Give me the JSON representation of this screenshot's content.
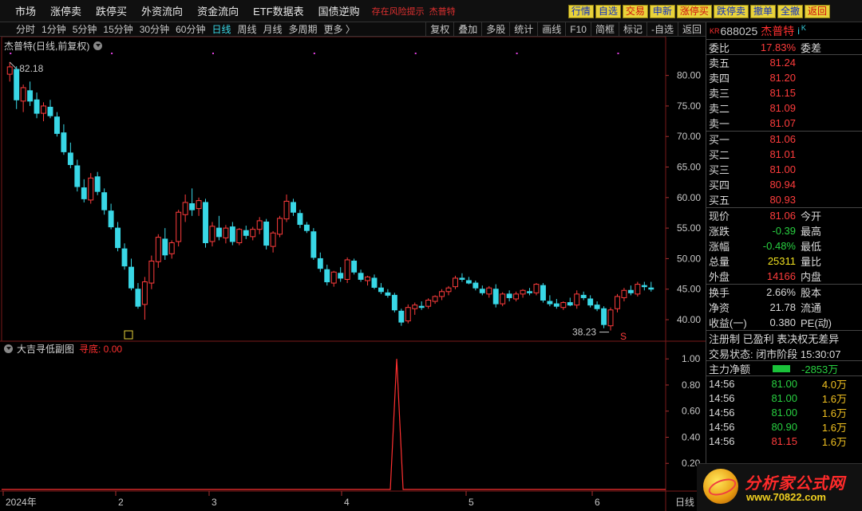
{
  "menu": {
    "items": [
      "市场",
      "涨停卖",
      "跌停买",
      "外资流向",
      "资金流向",
      "ETF数据表",
      "国债逆购"
    ],
    "warning": "存在风险提示",
    "stock_tag": "杰普特"
  },
  "quick_buttons": [
    {
      "label": "行情",
      "color": "blue"
    },
    {
      "label": "自选",
      "color": "blue"
    },
    {
      "label": "交易",
      "color": "red"
    },
    {
      "label": "申新",
      "color": "blue"
    },
    {
      "label": "涨停买",
      "color": "red"
    },
    {
      "label": "跌停卖",
      "color": "blue"
    },
    {
      "label": "撤单",
      "color": "blue"
    },
    {
      "label": "全撤",
      "color": "blue"
    },
    {
      "label": "返回",
      "color": "red"
    }
  ],
  "toolbar": {
    "periods": [
      "分时",
      "1分钟",
      "5分钟",
      "15分钟",
      "30分钟",
      "60分钟",
      "日线",
      "周线",
      "月线",
      "多周期",
      "更多 〉"
    ],
    "active_period": "日线",
    "right_buttons": [
      "复权",
      "叠加",
      "多股",
      "统计",
      "画线",
      "F10",
      "简框",
      "标记",
      "-自选",
      "返回"
    ]
  },
  "main_chart": {
    "title": "杰普特(日线,前复权)",
    "high_label": "82.18",
    "low_label": "38.23",
    "y_ticks": [
      "80.00",
      "75.00",
      "70.00",
      "65.00",
      "60.00",
      "55.00",
      "50.00",
      "45.00",
      "40.00"
    ],
    "x_labels": [
      "2024年",
      "2",
      "3",
      "4",
      "5",
      "6"
    ],
    "period_label": "日线",
    "signal_mark": "S",
    "box_mark": "回"
  },
  "sub_chart": {
    "title": "大吉寻低副图",
    "indicator_label": "寻底: 0.00",
    "y_ticks": [
      "1.00",
      "0.80",
      "0.60",
      "0.40",
      "0.20"
    ]
  },
  "chart_data": [
    {
      "type": "candlestick",
      "title": "杰普特(日线,前复权)",
      "ylim": [
        37,
        84
      ],
      "x_labels": [
        "2024年",
        "2",
        "3",
        "4",
        "5",
        "6"
      ],
      "candles": [
        [
          80.2,
          82.18,
          79.0,
          81.4
        ],
        [
          81.0,
          81.5,
          74.5,
          76.0
        ],
        [
          75.8,
          78.5,
          74.0,
          78.0
        ],
        [
          77.5,
          79.0,
          75.0,
          75.8
        ],
        [
          76.0,
          77.2,
          73.0,
          73.8
        ],
        [
          73.8,
          75.6,
          72.5,
          75.0
        ],
        [
          74.8,
          76.0,
          73.0,
          73.4
        ],
        [
          73.2,
          74.0,
          70.0,
          70.5
        ],
        [
          70.6,
          72.0,
          67.0,
          67.5
        ],
        [
          67.3,
          69.0,
          64.8,
          65.4
        ],
        [
          65.2,
          66.2,
          61.0,
          61.8
        ],
        [
          61.6,
          63.0,
          59.2,
          59.8
        ],
        [
          59.6,
          64.0,
          59.0,
          63.2
        ],
        [
          63.4,
          64.2,
          60.4,
          61.0
        ],
        [
          60.8,
          61.5,
          57.2,
          58.0
        ],
        [
          57.8,
          59.0,
          54.8,
          55.2
        ],
        [
          55.0,
          56.0,
          51.2,
          51.8
        ],
        [
          51.6,
          52.5,
          48.2,
          48.8
        ],
        [
          48.6,
          50.0,
          44.8,
          45.2
        ],
        [
          45.0,
          46.0,
          41.8,
          42.2
        ],
        [
          42.5,
          47.0,
          40.0,
          46.2
        ],
        [
          46.0,
          50.5,
          45.0,
          49.6
        ],
        [
          49.5,
          54.0,
          48.5,
          53.5
        ],
        [
          53.2,
          55.0,
          49.8,
          50.6
        ],
        [
          50.8,
          53.0,
          50.0,
          52.6
        ],
        [
          52.8,
          58.0,
          52.0,
          57.6
        ],
        [
          57.2,
          60.5,
          56.0,
          59.2
        ],
        [
          59.0,
          61.5,
          57.0,
          58.0
        ],
        [
          58.2,
          60.0,
          57.0,
          59.5
        ],
        [
          59.2,
          59.8,
          51.8,
          52.6
        ],
        [
          52.8,
          56.0,
          52.0,
          55.3
        ],
        [
          55.0,
          57.0,
          53.0,
          53.6
        ],
        [
          53.4,
          55.5,
          52.5,
          55.0
        ],
        [
          55.2,
          56.0,
          52.2,
          52.8
        ],
        [
          52.6,
          55.0,
          52.2,
          54.8
        ],
        [
          54.6,
          55.4,
          53.2,
          53.8
        ],
        [
          53.6,
          55.2,
          53.0,
          54.8
        ],
        [
          54.8,
          56.8,
          54.0,
          56.2
        ],
        [
          56.0,
          56.5,
          51.5,
          52.2
        ],
        [
          52.0,
          54.5,
          51.0,
          54.2
        ],
        [
          54.0,
          57.0,
          53.5,
          56.6
        ],
        [
          56.5,
          60.5,
          56.0,
          59.4
        ],
        [
          59.2,
          59.8,
          57.0,
          57.6
        ],
        [
          57.4,
          58.0,
          55.0,
          55.6
        ],
        [
          55.5,
          56.0,
          54.2,
          54.6
        ],
        [
          54.4,
          55.0,
          49.8,
          50.2
        ],
        [
          50.0,
          51.0,
          47.8,
          48.4
        ],
        [
          48.2,
          49.0,
          45.6,
          46.2
        ],
        [
          46.0,
          48.0,
          45.4,
          47.8
        ],
        [
          47.6,
          48.6,
          46.2,
          46.8
        ],
        [
          46.6,
          50.2,
          46.0,
          49.8
        ],
        [
          49.6,
          50.0,
          47.4,
          47.8
        ],
        [
          47.6,
          48.2,
          46.2,
          46.6
        ],
        [
          46.4,
          47.2,
          45.6,
          47.0
        ],
        [
          46.8,
          47.4,
          45.0,
          45.3
        ],
        [
          45.2,
          46.0,
          44.2,
          44.6
        ],
        [
          44.4,
          45.0,
          43.6,
          44.0
        ],
        [
          44.0,
          44.4,
          41.2,
          41.6
        ],
        [
          41.4,
          41.8,
          39.0,
          39.6
        ],
        [
          39.8,
          42.5,
          39.4,
          42.0
        ],
        [
          41.8,
          42.8,
          40.8,
          42.4
        ],
        [
          42.2,
          43.0,
          41.6,
          42.0
        ],
        [
          42.2,
          43.5,
          41.8,
          43.2
        ],
        [
          43.0,
          44.0,
          42.6,
          43.8
        ],
        [
          43.8,
          45.0,
          43.2,
          44.6
        ],
        [
          44.6,
          45.5,
          44.0,
          45.2
        ],
        [
          45.4,
          47.2,
          45.0,
          46.8
        ],
        [
          46.8,
          47.6,
          46.2,
          46.6
        ],
        [
          46.4,
          47.0,
          45.8,
          46.0
        ],
        [
          46.0,
          46.4,
          44.8,
          45.2
        ],
        [
          45.0,
          45.6,
          44.0,
          44.4
        ],
        [
          44.2,
          45.5,
          43.6,
          45.2
        ],
        [
          45.0,
          45.8,
          42.0,
          42.6
        ],
        [
          42.6,
          44.5,
          42.2,
          44.2
        ],
        [
          44.2,
          44.8,
          43.0,
          43.6
        ],
        [
          43.4,
          44.6,
          43.0,
          44.2
        ],
        [
          44.2,
          45.0,
          43.6,
          44.8
        ],
        [
          44.6,
          45.2,
          44.0,
          44.4
        ],
        [
          44.4,
          46.0,
          44.0,
          45.8
        ],
        [
          45.6,
          46.0,
          42.8,
          43.2
        ],
        [
          43.0,
          44.0,
          42.2,
          42.6
        ],
        [
          42.6,
          43.4,
          41.8,
          42.2
        ],
        [
          42.0,
          43.0,
          41.6,
          42.8
        ],
        [
          42.8,
          43.6,
          42.2,
          42.4
        ],
        [
          42.4,
          44.8,
          41.8,
          44.2
        ],
        [
          44.0,
          44.6,
          43.2,
          43.6
        ],
        [
          43.4,
          44.0,
          42.0,
          42.4
        ],
        [
          42.4,
          43.0,
          41.4,
          41.8
        ],
        [
          41.8,
          42.2,
          38.6,
          39.2
        ],
        [
          39.0,
          42.0,
          38.23,
          41.6
        ],
        [
          41.8,
          44.2,
          41.2,
          43.8
        ],
        [
          43.6,
          45.2,
          43.0,
          44.8
        ],
        [
          44.8,
          45.6,
          44.0,
          44.4
        ],
        [
          44.2,
          46.2,
          43.8,
          45.8
        ],
        [
          45.6,
          46.2,
          44.8,
          45.4
        ],
        [
          45.2,
          46.2,
          44.6,
          45.0
        ]
      ]
    },
    {
      "type": "line",
      "title": "大吉寻低副图",
      "series": [
        {
          "name": "寻底",
          "peak_x_fraction": 0.595,
          "peak_value": 1.0,
          "base_value": 0.0,
          "latest_value": 0.0
        }
      ],
      "ylim": [
        0,
        1.05
      ]
    }
  ],
  "quote_panel": {
    "kr": "KR",
    "code": "688025",
    "name": "杰普特",
    "info_icon": "i",
    "k_icon": "K",
    "webi_label": "委比",
    "webi_value": "17.83%",
    "wecha_label": "委差",
    "asks": [
      {
        "label": "卖五",
        "price": "81.24"
      },
      {
        "label": "卖四",
        "price": "81.20"
      },
      {
        "label": "卖三",
        "price": "81.15"
      },
      {
        "label": "卖二",
        "price": "81.09"
      },
      {
        "label": "卖一",
        "price": "81.07"
      }
    ],
    "bids": [
      {
        "label": "买一",
        "price": "81.06"
      },
      {
        "label": "买二",
        "price": "81.01"
      },
      {
        "label": "买三",
        "price": "81.00"
      },
      {
        "label": "买四",
        "price": "80.94"
      },
      {
        "label": "买五",
        "price": "80.93"
      }
    ],
    "stats": [
      {
        "label": "现价",
        "value": "81.06",
        "color": "red",
        "label2": "今开"
      },
      {
        "label": "涨跌",
        "value": "-0.39",
        "color": "green",
        "label2": "最高"
      },
      {
        "label": "涨幅",
        "value": "-0.48%",
        "color": "green",
        "label2": "最低"
      },
      {
        "label": "总量",
        "value": "25311",
        "color": "yellow",
        "label2": "量比"
      },
      {
        "label": "外盘",
        "value": "14166",
        "color": "red",
        "label2": "内盘"
      }
    ],
    "stats2": [
      {
        "label": "换手",
        "value": "2.66%",
        "color": "white",
        "label2": "股本"
      },
      {
        "label": "净资",
        "value": "21.78",
        "color": "white",
        "label2": "流通"
      },
      {
        "label": "收益(一)",
        "value": "0.380",
        "color": "white",
        "label2": "PE(动)"
      }
    ],
    "registration": "注册制  已盈利  表决权无差异",
    "trade_status": "交易状态: 闭市阶段 15:30:07",
    "mainforce_label": "主力净额",
    "mainforce_value": "-2853万",
    "ticks": [
      {
        "time": "14:56",
        "price": "81.00",
        "vol": "4.0万",
        "color": "green"
      },
      {
        "time": "14:56",
        "price": "81.00",
        "vol": "1.6万",
        "color": "green"
      },
      {
        "time": "14:56",
        "price": "81.00",
        "vol": "1.6万",
        "color": "green"
      },
      {
        "time": "14:56",
        "price": "80.90",
        "vol": "1.6万",
        "color": "green"
      },
      {
        "time": "14:56",
        "price": "81.15",
        "vol": "1.6万",
        "color": "red"
      }
    ]
  },
  "watermark": {
    "text": "分析家公式网",
    "url": "www.70822.com"
  },
  "colors": {
    "up": "#ff3c3c",
    "down": "#39d7e6",
    "grid": "#7a1a1a",
    "ma": "#e040e0"
  }
}
